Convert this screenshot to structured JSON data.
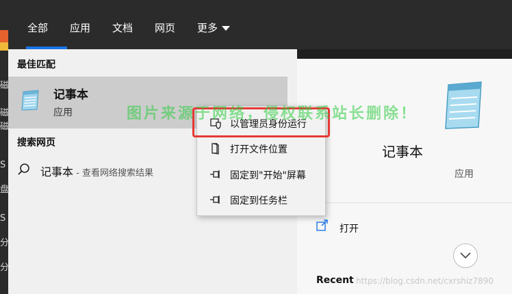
{
  "desktop": {
    "glyphs": [
      "磁",
      "磁",
      "磁",
      "S",
      "盘",
      "S",
      "分",
      "分"
    ]
  },
  "topbar": {
    "tabs": [
      "全部",
      "应用",
      "文档",
      "网页",
      "更多"
    ],
    "active_color": "#1a73e8"
  },
  "left": {
    "best_match_heading": "最佳匹配",
    "best_match": {
      "title": "记事本",
      "subtitle": "应用"
    },
    "web_heading": "搜索网页",
    "web_result": {
      "text": "记事本",
      "hint": " - 查看网络搜索结果"
    }
  },
  "context_menu": {
    "items": [
      {
        "label": "以管理员身份运行",
        "icon": "shield-icon"
      },
      {
        "label": "打开文件位置",
        "icon": "folder-icon"
      },
      {
        "label": "固定到\"开始\"屏幕",
        "icon": "pin-icon"
      },
      {
        "label": "固定到任务栏",
        "icon": "pin-icon"
      }
    ],
    "highlight_color": "#e53935"
  },
  "right": {
    "title": "记事本",
    "subtitle": "应用",
    "open_label": "打开",
    "recent_heading": "Recent"
  },
  "watermarks": {
    "overlay": "图片来源于网络，侵权联系站长删除！",
    "url": "https://blog.csdn.net/cxrshiz7890"
  }
}
